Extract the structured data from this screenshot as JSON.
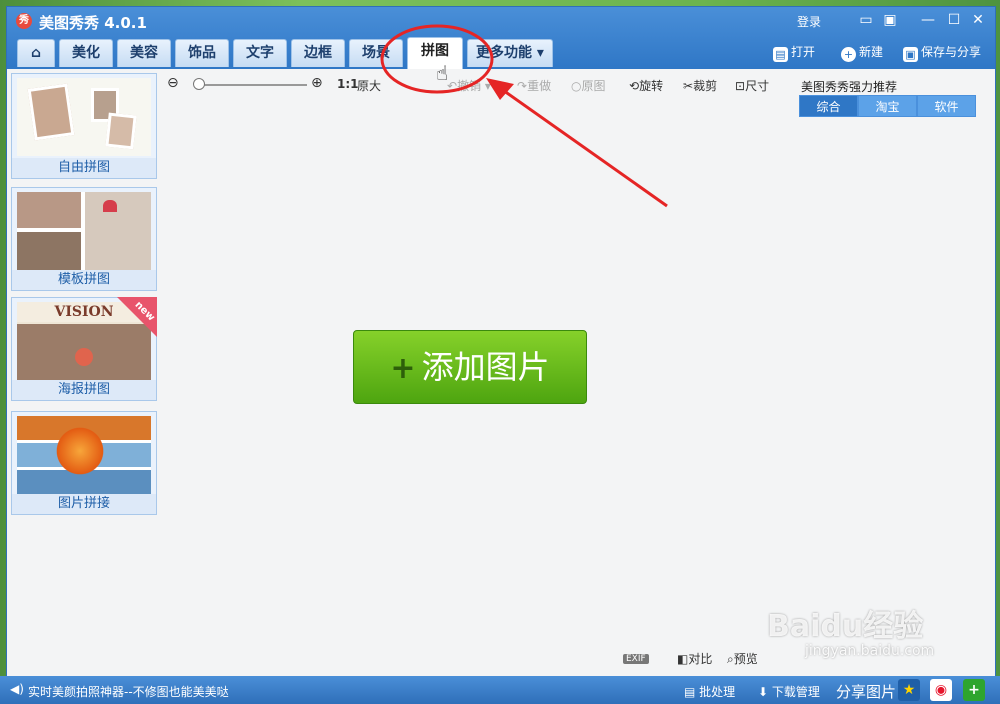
{
  "app": {
    "title": "美图秀秀 4.0.1",
    "logo_text": "秀"
  },
  "titlebar": {
    "login": "登录"
  },
  "tabs": [
    {
      "label": ""
    },
    {
      "label": "美化"
    },
    {
      "label": "美容"
    },
    {
      "label": "饰品"
    },
    {
      "label": "文字"
    },
    {
      "label": "边框"
    },
    {
      "label": "场景"
    },
    {
      "label": "拼图"
    },
    {
      "label": "更多功能 ▾"
    }
  ],
  "actions": {
    "open": "打开",
    "new": "新建",
    "save": "保存与分享"
  },
  "sidebar": [
    {
      "label": "自由拼图"
    },
    {
      "label": "模板拼图"
    },
    {
      "label": "海报拼图"
    },
    {
      "label": "图片拼接"
    }
  ],
  "sidebar_badge": "new",
  "sidebar_poster_text": "VISION",
  "toolbar": {
    "zoom_ratio": "1:1",
    "original_size": "原大",
    "undo": "撤销",
    "redo": "重做",
    "original": "原图",
    "rotate": "旋转",
    "crop": "裁剪",
    "resize": "尺寸"
  },
  "recommend": {
    "title": "美图秀秀强力推荐",
    "tabs": [
      "综合",
      "淘宝",
      "软件"
    ]
  },
  "main": {
    "add_button": "添加图片"
  },
  "bottom": {
    "exif": "EXIF",
    "compare": "对比",
    "preview": "预览"
  },
  "status": {
    "text": "实时美颜拍照神器--不修图也能美美哒",
    "batch": "批处理",
    "download": "下载管理",
    "share": "分享图片"
  },
  "watermark": {
    "text": "Baidu经验",
    "url": "jingyan.baidu.com"
  }
}
